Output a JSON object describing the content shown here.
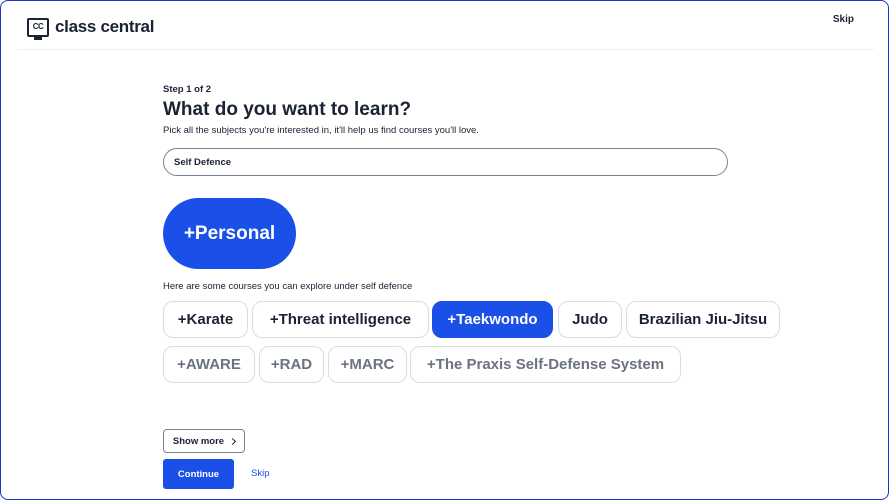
{
  "header": {
    "logo_mark": "CC",
    "logo_text": "class central",
    "skip_label": "Skip"
  },
  "main": {
    "step": "Step 1 of 2",
    "title": "What do you want to learn?",
    "subtitle": "Pick all the subjects you're interested in, it'll help us find courses you'll love.",
    "search_value": "Self Defence",
    "big_pill": "+Personal",
    "hint": "Here are some courses you can explore under self defence",
    "chips_row1": [
      {
        "label": "+Karate",
        "selected": false
      },
      {
        "label": "+Threat intelligence",
        "selected": false
      },
      {
        "label": "+Taekwondo",
        "selected": true
      },
      {
        "label": "Judo",
        "selected": false
      },
      {
        "label": "Brazilian Jiu-Jitsu",
        "selected": false
      }
    ],
    "chips_row2": [
      {
        "label": "+AWARE",
        "selected": false
      },
      {
        "label": "+RAD",
        "selected": false
      },
      {
        "label": "+MARC",
        "selected": false
      },
      {
        "label": "+The Praxis Self-Defense System",
        "selected": false
      }
    ],
    "show_more_label": "Show more",
    "continue_label": "Continue",
    "skip_label": "Skip"
  },
  "colors": {
    "accent": "#1a4fe8",
    "text": "#1a2233",
    "muted_text": "#6b7280",
    "border": "#d9dde3"
  }
}
